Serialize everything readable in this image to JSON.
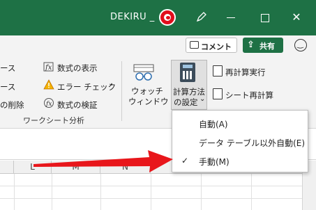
{
  "titlebar": {
    "title": "DEKIRU _",
    "color": "#1e7145"
  },
  "ribbon_top": {
    "comment_label": "コメント",
    "share_label": "共有"
  },
  "ribbon": {
    "partial_item_1": "ース",
    "partial_item_2": "ース",
    "partial_item_3": "の削除",
    "show_formulas": "数式の表示",
    "error_check": "エラー チェック",
    "evaluate_formula": "数式の検証",
    "watch_window_line1": "ウォッチ",
    "watch_window_line2": "ウィンドウ",
    "calc_options_line1": "計算方法",
    "calc_options_line2": "の設定",
    "calc_now": "再計算実行",
    "calc_sheet": "シート再計算",
    "group_label": "ワークシート分析"
  },
  "columns": [
    "L",
    "M",
    "N"
  ],
  "dropdown": {
    "items": [
      {
        "label": "自動(A)",
        "checked": false
      },
      {
        "label": "データ テーブル以外自動(E)",
        "checked": false
      },
      {
        "label": "手動(M)",
        "checked": true
      }
    ]
  },
  "annotation_arrow_color": "#e8161b"
}
